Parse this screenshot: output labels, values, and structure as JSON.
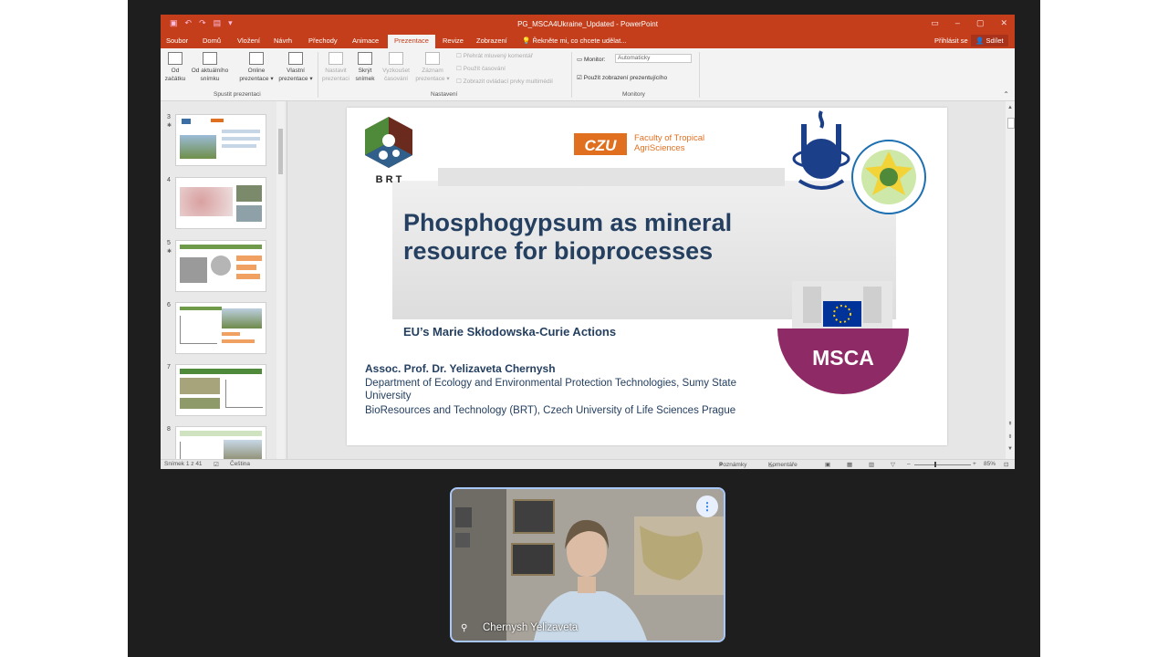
{
  "app": {
    "document_title": "PG_MSCA4Ukraine_Updated - PowerPoint",
    "tabs": [
      "Soubor",
      "Domů",
      "Vložení",
      "Návrh",
      "Přechody",
      "Animace",
      "Prezentace",
      "Revize",
      "Zobrazení"
    ],
    "active_tab": "Prezentace",
    "tell_me": "Řekněte mi, co chcete udělat...",
    "sign_in": "Přihlásit se",
    "share": "Sdílet"
  },
  "ribbon": {
    "buttons": {
      "from_start": [
        "Od",
        "začátku"
      ],
      "from_current": [
        "Od aktuálního",
        "snímku"
      ],
      "online": [
        "Online",
        "prezentace ▾"
      ],
      "custom": [
        "Vlastní",
        "prezentace ▾"
      ],
      "setup": [
        "Nastavit",
        "prezentaci"
      ],
      "hide": [
        "Skrýt",
        "snímek"
      ],
      "rehearse": [
        "Vyzkoušet",
        "časování"
      ],
      "record": [
        "Záznam",
        "prezentace ▾"
      ]
    },
    "checkboxes": {
      "narration": "Přehrát mluvený komentář",
      "timings": "Použít časování",
      "media": "Zobrazit ovládací prvky multimédií",
      "presenter_view": "Použít zobrazení prezentujícího"
    },
    "monitor_label": "Monitor:",
    "monitor_value": "Automaticky",
    "groups": {
      "start": "Spustit prezentaci",
      "setup": "Nastavení",
      "monitors": "Monitory"
    }
  },
  "thumbnails": [
    "3",
    "4",
    "5",
    "6",
    "7",
    "8"
  ],
  "slide": {
    "title": "Phosphogypsum as mineral resource for bioprocesses",
    "title_line1": "Phosphogypsum as mineral",
    "title_line2": "resource for bioprocesses",
    "subtitle": "EU’s Marie Skłodowska-Curie Actions",
    "author": "Assoc. Prof. Dr. Yelizaveta Chernysh",
    "affiliation1": "Department of Ecology and Environmental Protection Technologies, Sumy State University",
    "affiliation2": "BioResources and Technology (BRT), Czech University of Life Sciences Prague",
    "czu_text": "Faculty of Tropical AgriSciences",
    "czu_text1": "Faculty of Tropical",
    "czu_text2": "AgriSciences",
    "czu_mark": "CZU",
    "brt_label": "B  R  T",
    "msca_label": "MSCA"
  },
  "status": {
    "slide_info": "Snímek 1 z 41",
    "language": "Čeština",
    "notes": "Poznámky",
    "comments": "Komentáře",
    "zoom": "85%"
  },
  "participant": {
    "name": "Chernysh Yelizaveta"
  },
  "colors": {
    "accent": "#c43e1c",
    "title_text": "#243f60",
    "msca_purple": "#8e2a66",
    "video_border": "#a8c7fa"
  }
}
